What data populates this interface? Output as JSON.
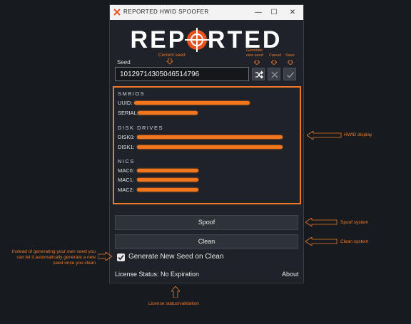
{
  "window": {
    "title": "REPORTED HWID SPOOFER",
    "minimize": "—",
    "maximize": "☐",
    "close": "✕"
  },
  "logo": {
    "text": "REPORTED"
  },
  "seed": {
    "label": "Seed",
    "value": "10129714305046514796"
  },
  "buttons": {
    "generate_icon": "shuffle-icon",
    "cancel_icon": "close-icon",
    "save_icon": "check-icon"
  },
  "sections": {
    "smbios": {
      "title": "SMBIOS",
      "rows": [
        {
          "label": "UUID:"
        },
        {
          "label": "SERIAL:"
        }
      ]
    },
    "drives": {
      "title": "DISK DRIVES",
      "rows": [
        {
          "label": "DISK0:"
        },
        {
          "label": "DISK1:"
        }
      ]
    },
    "nics": {
      "title": "NICS",
      "rows": [
        {
          "label": "MAC0:"
        },
        {
          "label": "MAC1:"
        },
        {
          "label": "MAC2:"
        }
      ]
    }
  },
  "actions": {
    "spoof": "Spoof",
    "clean": "Clean"
  },
  "options": {
    "generate_new_seed_label": "Generate New Seed on Clean",
    "generate_new_seed_checked": true
  },
  "footer": {
    "license_label": "License Status:",
    "license_value": "No Expiration",
    "about": "About"
  },
  "annotations": {
    "current_seed": "Current seed",
    "generate_new_seed": "Generate new seed",
    "cancel": "Cancel",
    "save": "Save",
    "hwid_display": "HWID display",
    "spoof_system": "Spoof system",
    "clean_system": "Clean system",
    "checkbox_note": "Instead of generating your own seed you can let it automatically generate a new seed once you clean",
    "license_note": "License status/validation"
  },
  "colors": {
    "accent": "#f07a2a",
    "background": "#171a1f",
    "window": "#1f2228"
  }
}
